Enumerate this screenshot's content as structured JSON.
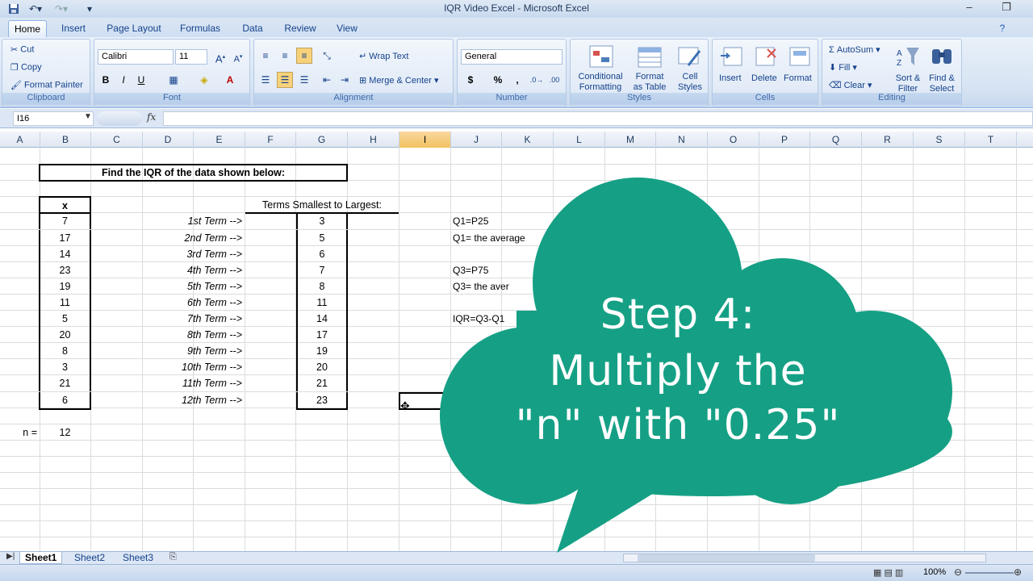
{
  "window": {
    "title": "IQR Video Excel - Microsoft Excel"
  },
  "tabs": [
    "Home",
    "Insert",
    "Page Layout",
    "Formulas",
    "Data",
    "Review",
    "View"
  ],
  "ribbon": {
    "clipboard": {
      "cut": "Cut",
      "copy": "Copy",
      "format_painter": "Format Painter",
      "label": "Clipboard"
    },
    "font": {
      "name": "Calibri",
      "size": "11",
      "bold": "B",
      "italic": "I",
      "underline": "U",
      "label": "Font"
    },
    "alignment": {
      "wrap_text": "Wrap Text",
      "merge_center": "Merge & Center",
      "label": "Alignment"
    },
    "number": {
      "format": "General",
      "currency": "$",
      "percent": "%",
      "comma": ",",
      "label": "Number"
    },
    "styles": {
      "conditional_1": "Conditional",
      "conditional_2": "Formatting",
      "table_1": "Format",
      "table_2": "as Table",
      "cell_1": "Cell",
      "cell_2": "Styles",
      "label": "Styles"
    },
    "cells": {
      "insert": "Insert",
      "delete": "Delete",
      "format": "Format",
      "label": "Cells"
    },
    "editing": {
      "autosum": "AutoSum",
      "fill": "Fill",
      "clear": "Clear",
      "sort_1": "Sort &",
      "sort_2": "Filter",
      "find_1": "Find &",
      "find_2": "Select",
      "label": "Editing"
    }
  },
  "formula_bar": {
    "name_box": "I16",
    "fx": "fx",
    "value": ""
  },
  "columns": [
    "A",
    "B",
    "C",
    "D",
    "E",
    "F",
    "G",
    "H",
    "I",
    "J",
    "K",
    "L",
    "M",
    "N",
    "O",
    "P",
    "Q",
    "R",
    "S",
    "T"
  ],
  "sheet": {
    "heading": "Find the IQR of the data shown below:",
    "x_header": "x",
    "x_values": [
      "7",
      "17",
      "14",
      "23",
      "19",
      "11",
      "5",
      "20",
      "8",
      "3",
      "21",
      "6"
    ],
    "term_labels": [
      "1st Term -->",
      "2nd Term -->",
      "3rd Term -->",
      "4th Term -->",
      "5th Term -->",
      "6th Term -->",
      "7th Term -->",
      "8th Term -->",
      "9th Term -->",
      "10th Term -->",
      "11th Term -->",
      "12th Term -->"
    ],
    "sorted_header": "Terms Smallest to Largest:",
    "sorted_values": [
      "3",
      "5",
      "6",
      "7",
      "8",
      "11",
      "14",
      "17",
      "19",
      "20",
      "21",
      "23"
    ],
    "notes": [
      "Q1=P25",
      "Q1= the average",
      "Q3=P75",
      "Q3= the aver",
      "IQR=Q3-Q1"
    ],
    "n_label": "n =",
    "n_value": "12"
  },
  "sheet_tabs": [
    "Sheet1",
    "Sheet2",
    "Sheet3"
  ],
  "status": {
    "zoom": "100%"
  },
  "overlay": {
    "line1": "Step 4:",
    "line2": "Multiply the",
    "line3": "\"n\" with \"0.25\"",
    "color": "#15a085"
  }
}
